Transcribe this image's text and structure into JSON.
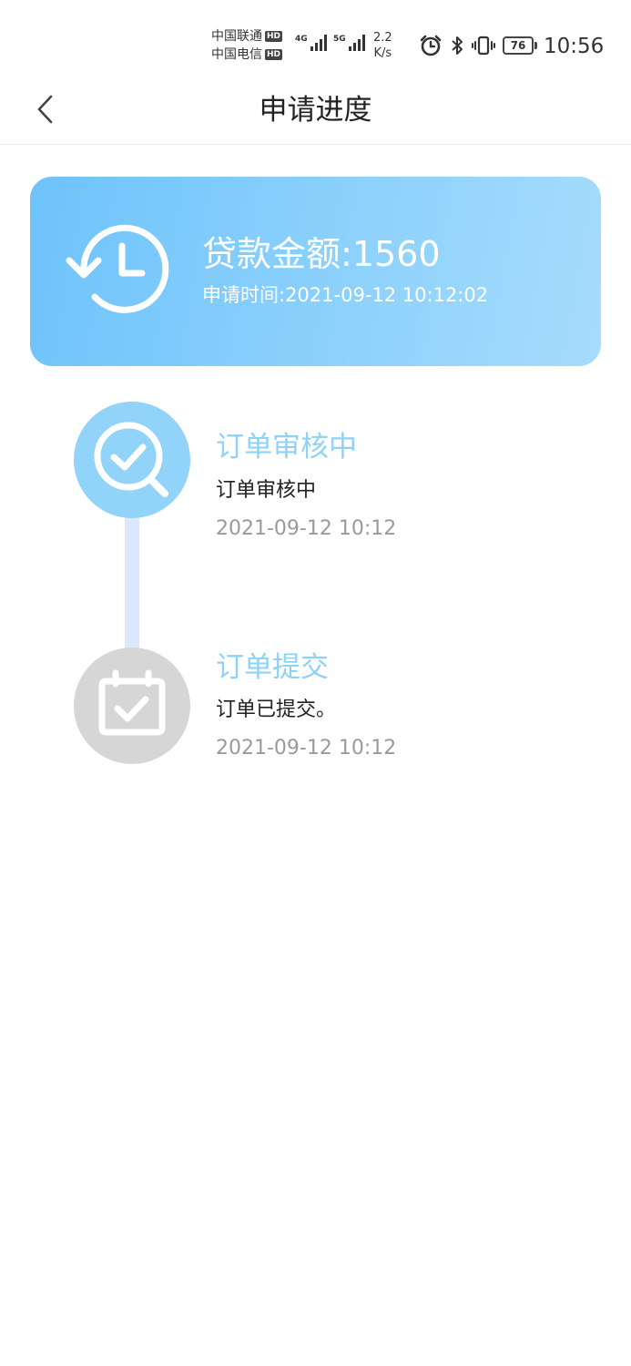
{
  "status_bar": {
    "carrier_1": "中国联通",
    "carrier_2": "中国电信",
    "hd_badge": "HD",
    "signal_1_label": "4G",
    "signal_2_label": "5G",
    "net_speed_value": "2.2",
    "net_speed_unit": "K/s",
    "battery_level": "76",
    "time": "10:56",
    "icons": [
      "alarm-icon",
      "bluetooth-icon",
      "vibrate-icon",
      "battery-icon"
    ]
  },
  "header": {
    "back_icon": "chevron-left-icon",
    "title": "申请进度"
  },
  "loan_card": {
    "icon": "history-clock-icon",
    "amount_text": "贷款金额:1560",
    "time_text": "申请时间:2021-09-12 10:12:02",
    "gradient_colors": [
      "#6ec3fb",
      "#a6dcfd"
    ]
  },
  "timeline": {
    "line_color": "#dce8fd",
    "steps": [
      {
        "icon": "search-check-icon",
        "title": "订单审核中",
        "description": "订单审核中",
        "time": "2021-09-12 10:12",
        "circle_color": "#92d3f9"
      },
      {
        "icon": "calendar-check-icon",
        "title": "订单提交",
        "description": "订单已提交。",
        "time": "2021-09-12 10:12",
        "circle_color": "#d6d6d6"
      }
    ]
  }
}
